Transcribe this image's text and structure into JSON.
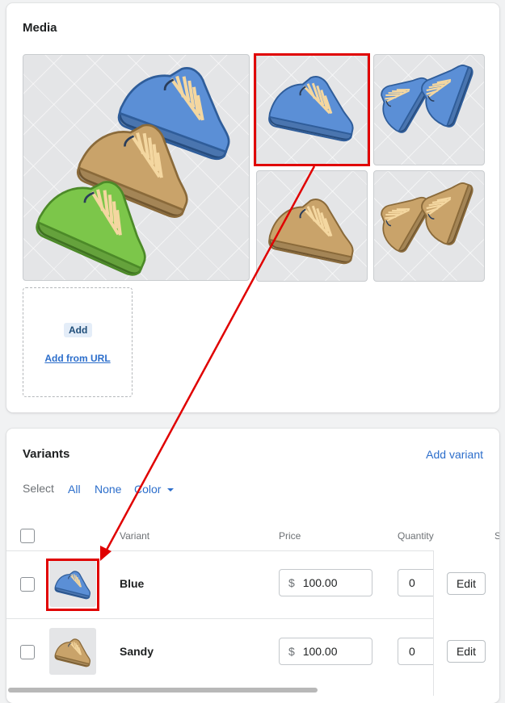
{
  "media": {
    "title": "Media",
    "add_label": "Add",
    "add_from_url_label": "Add from URL",
    "images": [
      {
        "name": "group-shoes",
        "colors": [
          "blue",
          "sandy",
          "green"
        ]
      },
      {
        "name": "blue-shoe-side",
        "selected": true
      },
      {
        "name": "blue-shoes-pair"
      },
      {
        "name": "sandy-shoe-side"
      },
      {
        "name": "sandy-shoes-pair"
      }
    ]
  },
  "variants": {
    "title": "Variants",
    "add_variant_label": "Add variant",
    "select_label": "Select",
    "filters": [
      "All",
      "None",
      "Color"
    ],
    "columns": [
      "Variant",
      "Price",
      "Quantity",
      "S"
    ],
    "rows": [
      {
        "name": "Blue",
        "currency": "$",
        "price": "100.00",
        "quantity": "0",
        "edit_label": "Edit",
        "thumb": "blue"
      },
      {
        "name": "Sandy",
        "currency": "$",
        "price": "100.00",
        "quantity": "0",
        "edit_label": "Edit",
        "thumb": "sandy"
      }
    ]
  },
  "colors": {
    "accent": "#2c6ecb",
    "highlight": "#e00000",
    "shoe_blue": "#5b8fd6",
    "shoe_sandy": "#c9a36a",
    "shoe_green": "#7cc64a"
  },
  "icons": {
    "dropdown": "caret-down-icon",
    "annotation": "red-arrow"
  }
}
